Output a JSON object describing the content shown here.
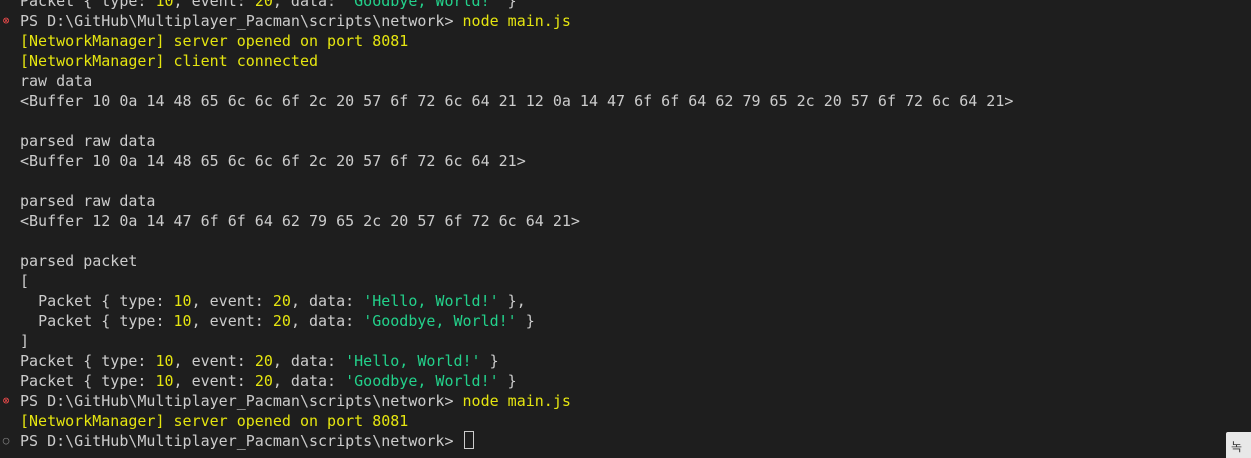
{
  "terminal": {
    "prompt": "PS D:\\GitHub\\Multiplayer_Pacman\\scripts\\network>",
    "command": "node main.js",
    "nm_opened": "[NetworkManager] server opened on port 8081",
    "nm_client": "[NetworkManager] client connected",
    "raw_label": "raw data",
    "raw_buffer": "<Buffer 10 0a 14 48 65 6c 6c 6f 2c 20 57 6f 72 6c 64 21 12 0a 14 47 6f 6f 64 62 79 65 2c 20 57 6f 72 6c 64 21>",
    "parsed_raw_label": "parsed raw data",
    "parsed_buffer_1": "<Buffer 10 0a 14 48 65 6c 6c 6f 2c 20 57 6f 72 6c 64 21>",
    "parsed_buffer_2": "<Buffer 12 0a 14 47 6f 6f 64 62 79 65 2c 20 57 6f 72 6c 64 21>",
    "parsed_packet_label": "parsed packet",
    "open_bracket": "[",
    "close_bracket": "]",
    "packet": {
      "prefix": "Packet { type: ",
      "type": "10",
      "event_label": ", event: ",
      "event": "20",
      "data_label": ", data: ",
      "data_hello": "'Hello, World!'",
      "data_goodbye": "'Goodbye, World!'",
      "suffix": " }",
      "comma": ","
    },
    "indent": "  ",
    "error_icon": "⊗",
    "ok_icon": "○"
  },
  "badge": {
    "text": "녹"
  }
}
